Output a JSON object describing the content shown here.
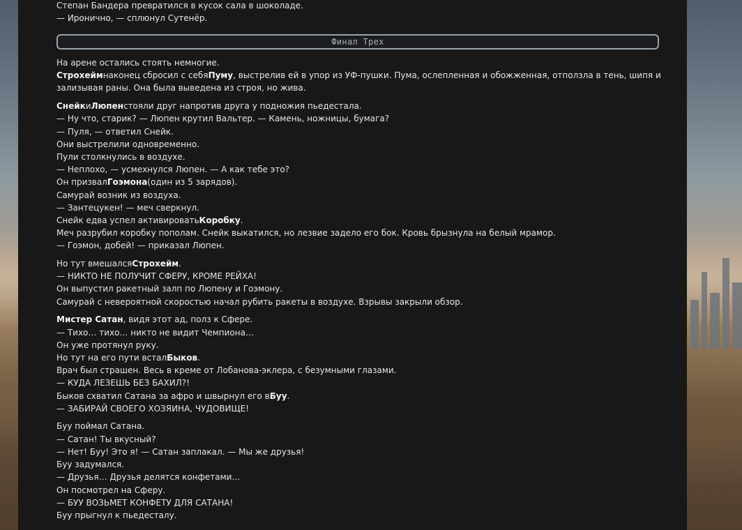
{
  "top_lines": [
    "Степан Бандера превратился в кусок сала в шоколаде.",
    "— Иронично, — сплюнул Сутенёр."
  ],
  "section": {
    "title": "Финал Трех"
  },
  "blocks": [
    {
      "lines": [
        [
          "На арене остались стоять немногие."
        ],
        [
          "<b>Строхейм</b>наконец сбросил с себя<b>Пуму</b>, выстрелив ей в упор из УФ-пушки. Пума, ослепленная и обожженная, отползла в тень, шипя и"
        ],
        [
          "зализывая раны. Она была выведена из строя, но жива."
        ]
      ]
    }
  ],
  "p1": {
    "l1": "На арене остались стоять немногие.",
    "l2_b1": "Строхейм",
    "l2_t1": "наконец сбросил с себя",
    "l2_b2": "Пуму",
    "l2_t2": ", выстрелив ей в упор из УФ-пушки. Пума, ослепленная и обожженная, отползла в тень, шипя и",
    "l3": "зализывая раны. Она была выведена из строя, но жива."
  },
  "p2": {
    "l1_b1": "Снейк",
    "l1_t1": "и",
    "l1_b2": "Люпен",
    "l1_t2": "стояли друг напротив друга у подножия пьедестала.",
    "l2": "— Ну что, старик? — Люпен крутил Вальтер. — Камень, ножницы, бумага?",
    "l3": "— Пуля, — ответил Снейк.",
    "l4": "Они выстрелили одновременно.",
    "l5": "Пули столкнулись в воздухе.",
    "l6": "— Неплохо, — усмехнулся Люпен. — А как тебе это?",
    "l7_t1": "Он призвал",
    "l7_b1": "Гоэмона",
    "l7_t2": "(один из 5 зарядов).",
    "l8": "Самурай возник из воздуха.",
    "l9": "— Зантецукен! — меч сверкнул.",
    "l10_t1": "Снейк едва успел активировать",
    "l10_b1": "Коробку",
    "l10_t2": ".",
    "l11": "Меч разрубил коробку пополам. Снейк выкатился, но лезвие задело его бок. Кровь брызнула на белый мрамор.",
    "l12": "— Гоэмон, добей! — приказал Люпен."
  },
  "p3": {
    "l1_t1": "Но тут вмешался",
    "l1_b1": "Строхейм",
    "l1_t2": ".",
    "l2": "— НИКТО НЕ ПОЛУЧИТ СФЕРУ, КРОМЕ РЕЙХА!",
    "l3": "Он выпустил ракетный залп по Люпену и Гоэмону.",
    "l4": "Самурай с невероятной скоростью начал рубить ракеты в воздухе. Взрывы закрыли обзор."
  },
  "p4": {
    "l1_b1": "Мистер Сатан",
    "l1_t1": ", видя этот ад, полз к Сфере.",
    "l2": "— Тихо… тихо… никто не видит Чемпиона…",
    "l3": "Он уже протянул руку.",
    "l4_t1": "Но тут на его пути встал",
    "l4_b1": "Быков",
    "l4_t2": ".",
    "l5": "Врач был страшен. Весь в креме от Лобанова-эклера, с безумными глазами.",
    "l6": "— КУДА ЛЕЗЕШЬ БЕЗ БАХИЛ?!",
    "l7_t1": "Быков схватил Сатана за афро и швырнул его в",
    "l7_b1": "Буу",
    "l7_t2": ".",
    "l8": "— ЗАБИРАЙ СВОЕГО ХОЗЯИНА, ЧУДОВИЩЕ!"
  },
  "p5": {
    "l1": "Буу поймал Сатана.",
    "l2": "— Сатан! Ты вкусный?",
    "l3": "— Нет! Буу! Это я! — Сатан заплакал. — Мы же друзья!",
    "l4": "Буу задумался.",
    "l5": "— Друзья… Друзья делятся конфетами…",
    "l6": "Он посмотрел на Сферу.",
    "l7": "— БУУ ВОЗЬМЕТ КОНФЕТУ ДЛЯ САТАНА!",
    "l8": "Буу прыгнул к пьедесталу."
  }
}
